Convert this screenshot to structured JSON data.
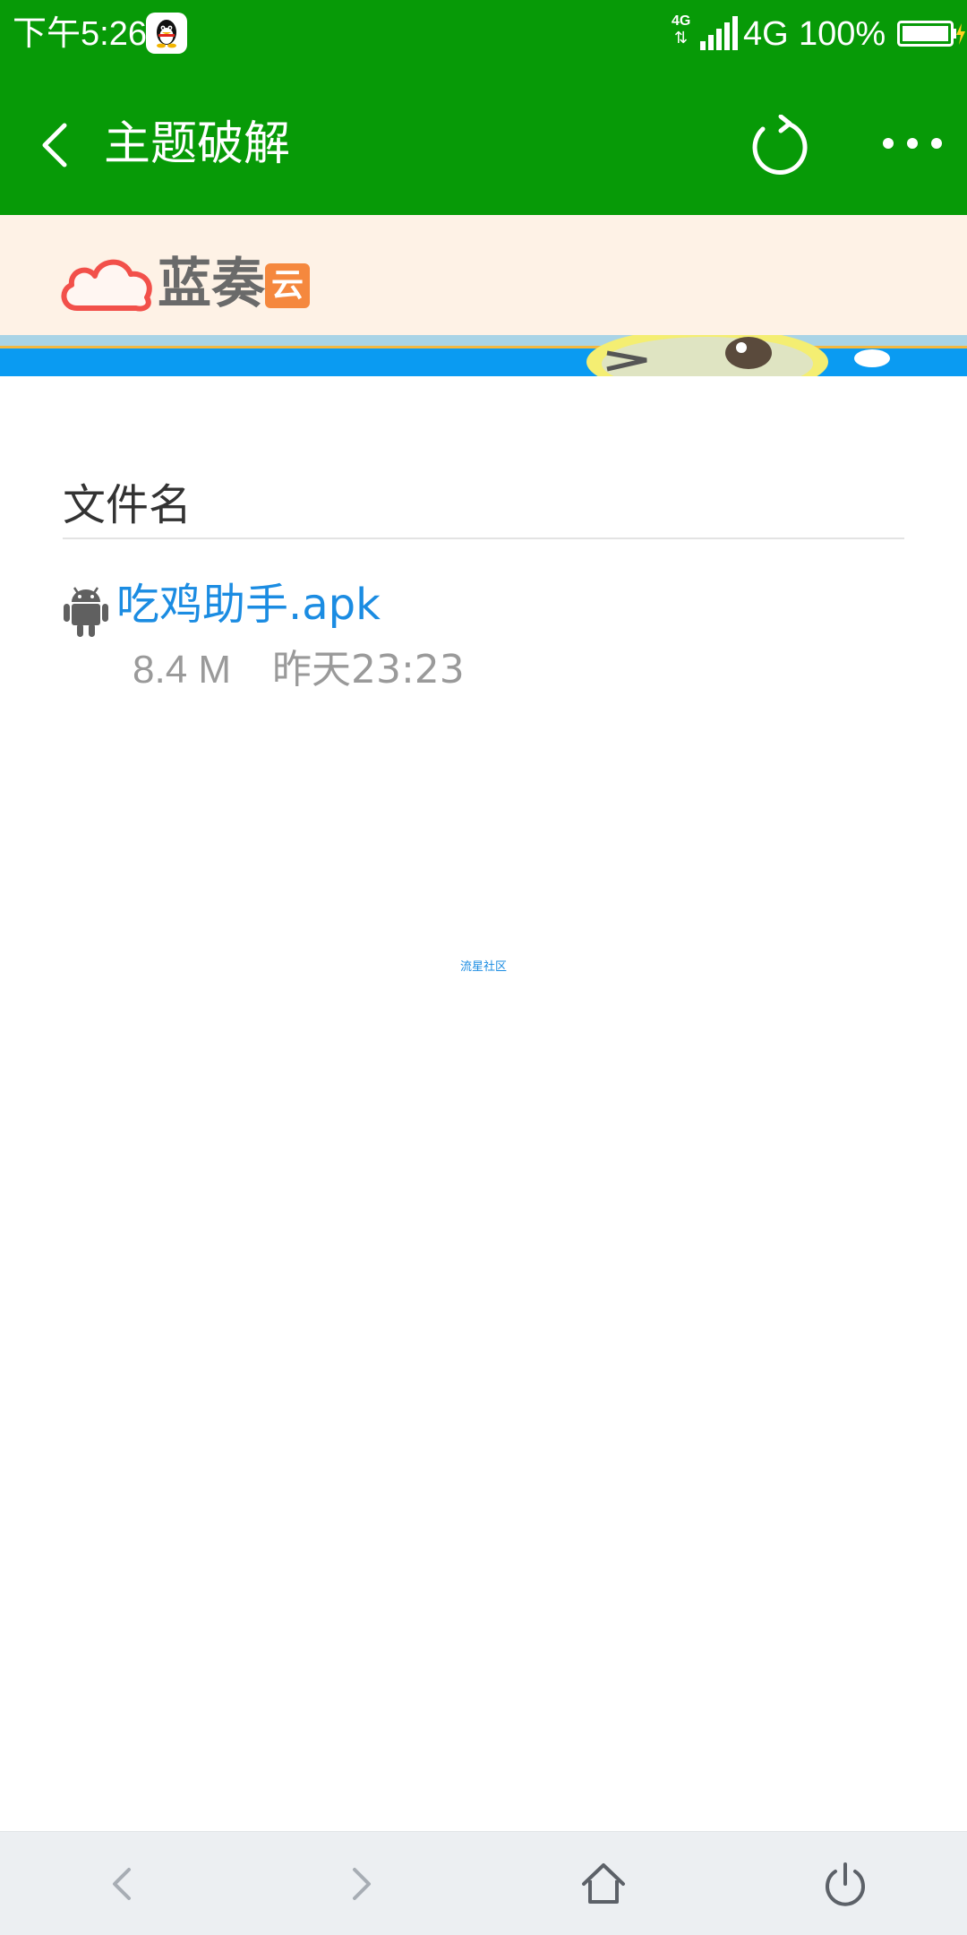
{
  "status_bar": {
    "time": "下午5:26",
    "network_small": "4G",
    "network": "4G",
    "battery": "100%"
  },
  "app_bar": {
    "title": "主题破解",
    "back_icon": "chevron-left-icon",
    "refresh_icon": "refresh-icon",
    "more_icon": "more-dots-icon"
  },
  "banner": {
    "brand_text": "蓝奏",
    "brand_badge": "云"
  },
  "file_list": {
    "header": "文件名",
    "items": [
      {
        "name": "吃鸡助手.apk",
        "size": "8.4 M",
        "time": "昨天23:23",
        "icon": "android-icon"
      }
    ]
  },
  "footer": {
    "link_text": "流星社区"
  },
  "toolbar": {
    "back_icon": "chevron-left-icon",
    "forward_icon": "chevron-right-icon",
    "home_icon": "home-icon",
    "power_icon": "power-icon"
  },
  "colors": {
    "primary_green": "#079a07",
    "link_blue": "#1b8ce2",
    "banner_bg": "#fef2e6",
    "lanzou_orange": "#f5883e",
    "toolbar_bg": "#eceff2"
  }
}
